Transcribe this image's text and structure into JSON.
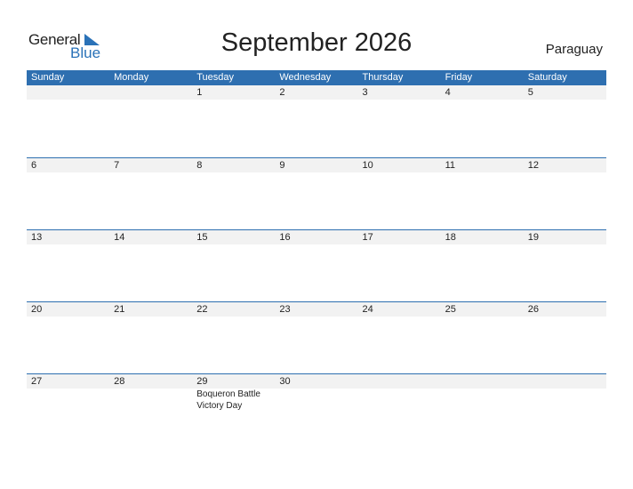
{
  "logo": {
    "word1": "General",
    "word2": "Blue"
  },
  "title": "September 2026",
  "country": "Paraguay",
  "colors": {
    "accent": "#2e6fb0",
    "band": "#f2f2f2"
  },
  "days": [
    "Sunday",
    "Monday",
    "Tuesday",
    "Wednesday",
    "Thursday",
    "Friday",
    "Saturday"
  ],
  "weeks": [
    [
      {
        "d": ""
      },
      {
        "d": ""
      },
      {
        "d": "1"
      },
      {
        "d": "2"
      },
      {
        "d": "3"
      },
      {
        "d": "4"
      },
      {
        "d": "5"
      }
    ],
    [
      {
        "d": "6"
      },
      {
        "d": "7"
      },
      {
        "d": "8"
      },
      {
        "d": "9"
      },
      {
        "d": "10"
      },
      {
        "d": "11"
      },
      {
        "d": "12"
      }
    ],
    [
      {
        "d": "13"
      },
      {
        "d": "14"
      },
      {
        "d": "15"
      },
      {
        "d": "16"
      },
      {
        "d": "17"
      },
      {
        "d": "18"
      },
      {
        "d": "19"
      }
    ],
    [
      {
        "d": "20"
      },
      {
        "d": "21"
      },
      {
        "d": "22"
      },
      {
        "d": "23"
      },
      {
        "d": "24"
      },
      {
        "d": "25"
      },
      {
        "d": "26"
      }
    ],
    [
      {
        "d": "27"
      },
      {
        "d": "28"
      },
      {
        "d": "29",
        "event": "Boqueron Battle Victory Day"
      },
      {
        "d": "30"
      },
      {
        "d": ""
      },
      {
        "d": ""
      },
      {
        "d": ""
      }
    ]
  ]
}
